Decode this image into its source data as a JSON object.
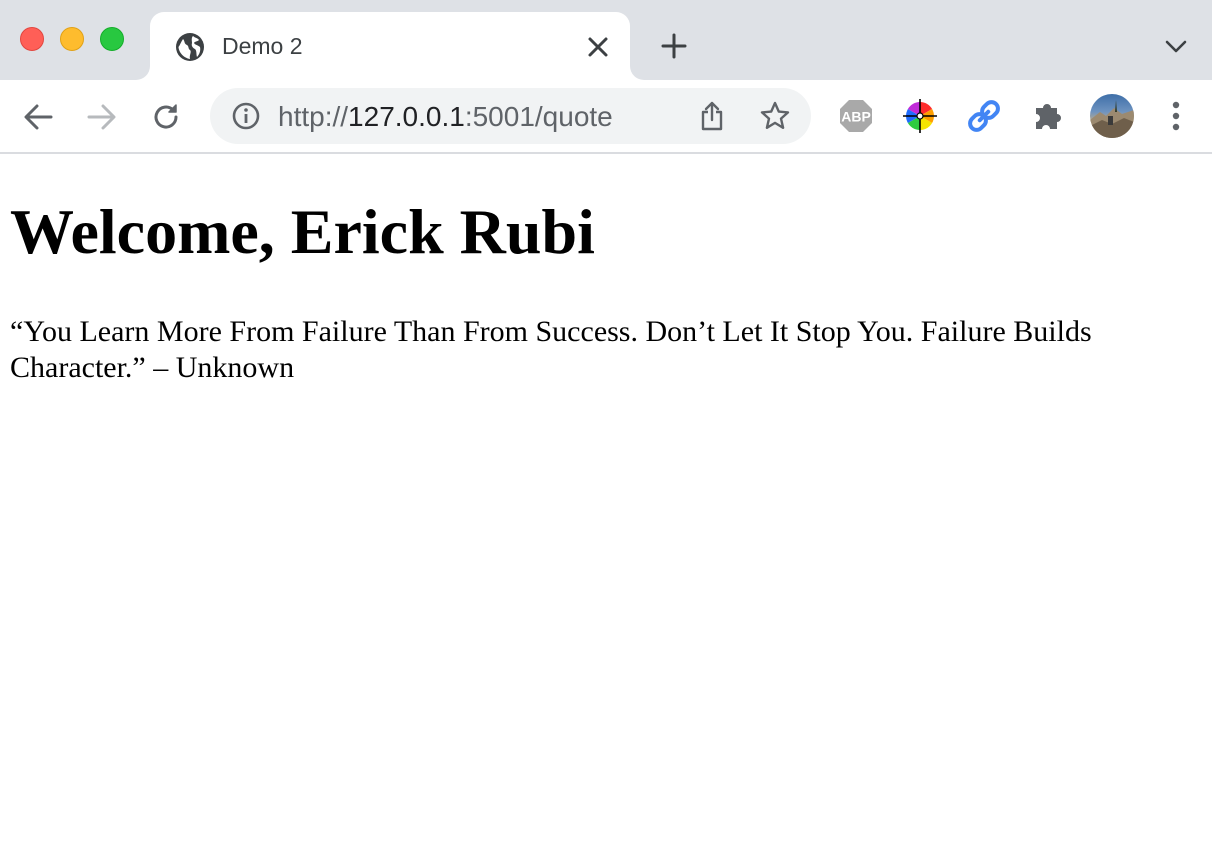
{
  "tab": {
    "title": "Demo 2",
    "favicon": "globe-icon"
  },
  "toolbar": {
    "url_scheme": "http://",
    "url_host": "127.0.0.1",
    "url_rest": ":5001/quote",
    "extensions": [
      "adblock-plus-icon",
      "color-picker-icon",
      "link-icon",
      "puzzle-icon"
    ],
    "adblock_label": "ABP"
  },
  "page": {
    "heading": "Welcome, Erick Rubi",
    "quote": "“You Learn More From Failure Than From Success. Don’t Let It Stop You. Failure Builds Character.” – Unknown"
  },
  "colors": {
    "tabstrip_bg": "#dee1e6",
    "omnibox_bg": "#f1f3f4",
    "link_icon_blue": "#4285f4"
  }
}
